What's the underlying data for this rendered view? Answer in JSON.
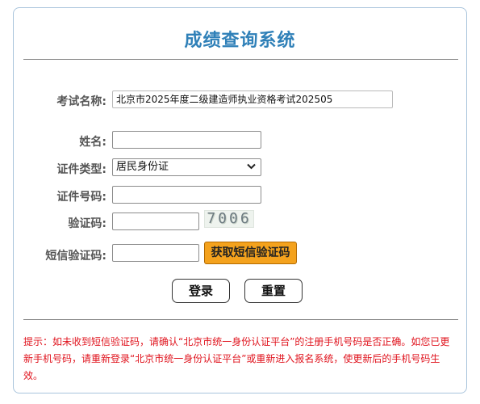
{
  "title": "成绩查询系统",
  "form": {
    "exam_name_label": "考试名称:",
    "exam_name_value": "北京市2025年度二级建造师执业资格考试202505",
    "name_label": "姓名:",
    "name_value": "",
    "id_type_label": "证件类型:",
    "id_type_value": "居民身份证",
    "id_number_label": "证件号码:",
    "id_number_value": "",
    "captcha_label": "验证码:",
    "captcha_value": "",
    "captcha_image_text": "7006",
    "sms_label": "短信验证码:",
    "sms_value": "",
    "sms_button": "获取短信验证码"
  },
  "actions": {
    "login": "登录",
    "reset": "重置"
  },
  "tip": "提示：如未收到短信验证码，请确认“北京市统一身份认证平台”的注册手机号码是否正确。如您已更新手机号码，请重新登录“北京市统一身份认证平台”或重新进入报名系统，使更新后的手机号码生效。",
  "colors": {
    "title": "#2f80b8",
    "sms_button_bg": "#f4a21d",
    "tip_text": "#e0141e",
    "panel_border": "#a9c4dc"
  }
}
